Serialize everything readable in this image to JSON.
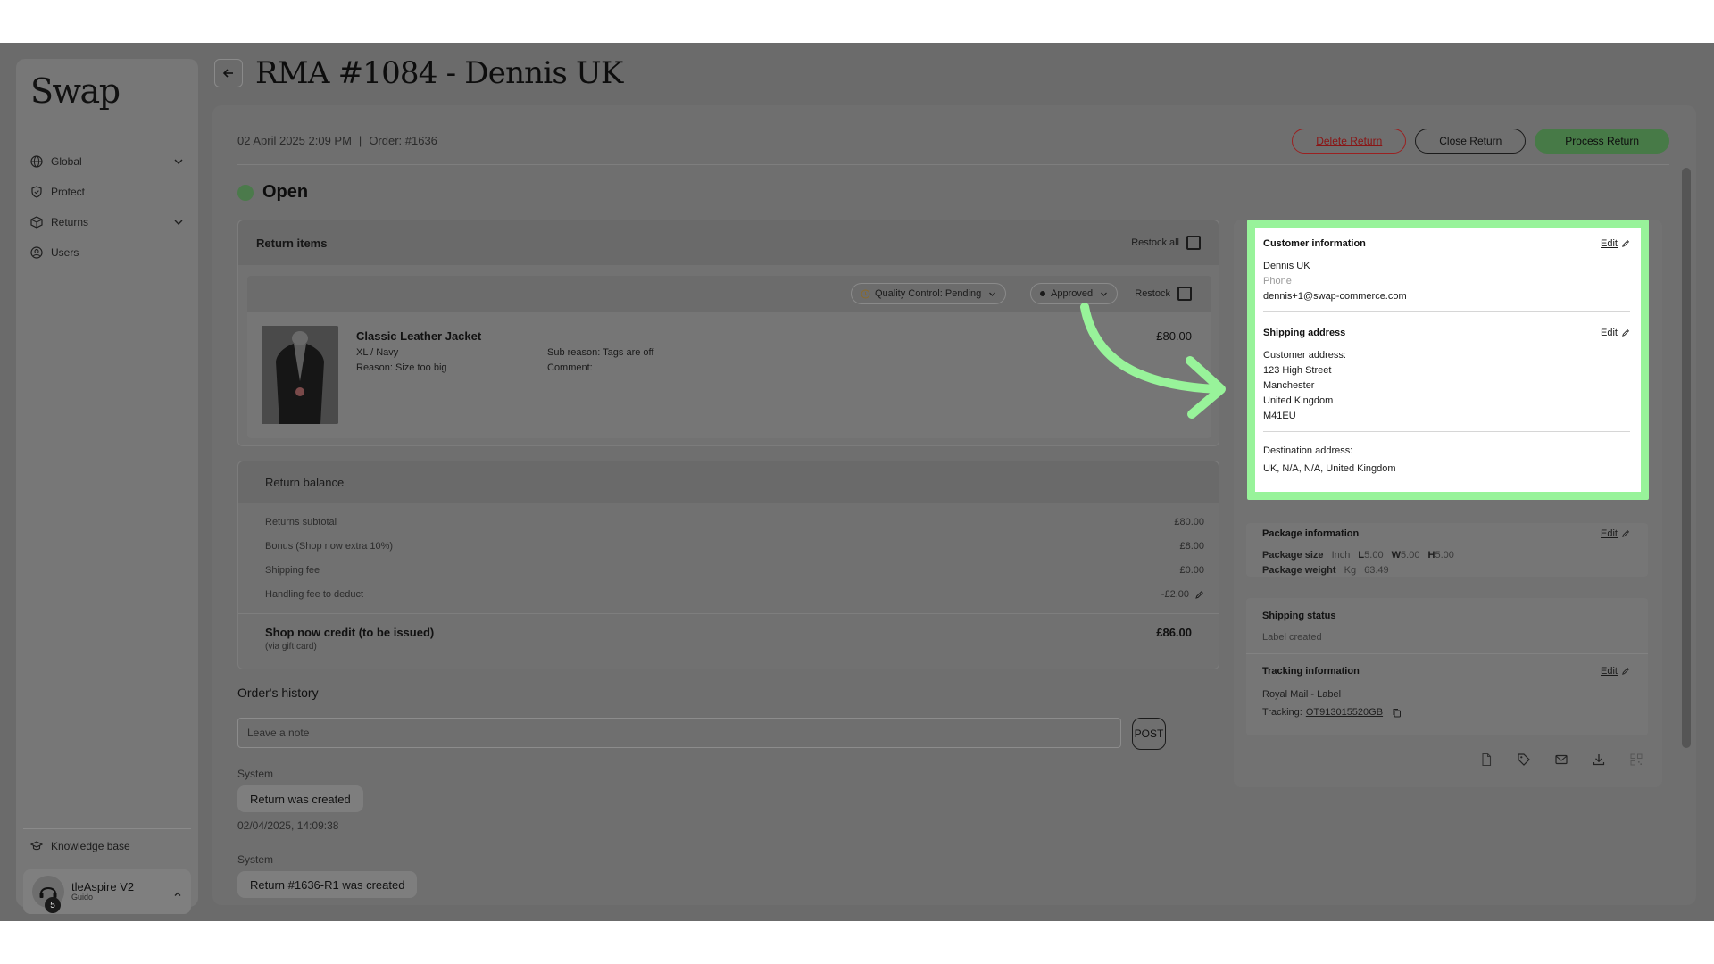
{
  "brand": {
    "logo": "Swap"
  },
  "sidebar": {
    "items": [
      {
        "label": "Global",
        "icon": "globe-icon",
        "expandable": true
      },
      {
        "label": "Protect",
        "icon": "shield-icon",
        "expandable": false
      },
      {
        "label": "Returns",
        "icon": "box-icon",
        "expandable": true
      },
      {
        "label": "Users",
        "icon": "user-circle-icon",
        "expandable": false
      }
    ],
    "knowledge_base": "Knowledge base",
    "account": {
      "name": "tleAspire V2",
      "sub": "Guido",
      "badge": "5"
    }
  },
  "header": {
    "title": "RMA #1084 - Dennis UK"
  },
  "meta": {
    "date": "02 April 2025 2:09 PM",
    "separator": "|",
    "order": "Order: #1636"
  },
  "actions": {
    "delete": "Delete Return",
    "close": "Close Return",
    "process": "Process Return"
  },
  "status": {
    "label": "Open",
    "color": "#4b7a4b"
  },
  "return_items": {
    "title": "Return items",
    "restock_all": "Restock all",
    "item": {
      "qc_status": "Quality Control: Pending",
      "approval": "Approved",
      "restock": "Restock",
      "name": "Classic Leather Jacket",
      "variant": "XL / Navy",
      "reason": "Reason: Size too big",
      "sub_reason": "Sub reason: Tags are off",
      "comment": "Comment:",
      "price": "£80.00"
    }
  },
  "balance": {
    "title": "Return balance",
    "rows": [
      {
        "label": "Returns subtotal",
        "value": "£80.00"
      },
      {
        "label": "Bonus (Shop now extra 10%)",
        "value": "£8.00"
      },
      {
        "label": "Shipping fee",
        "value": "£0.00"
      },
      {
        "label": "Handling fee to deduct",
        "value": "-£2.00"
      }
    ],
    "total_label": "Shop now credit (to be issued)",
    "total_sub": "(via gift card)",
    "total_value": "£86.00"
  },
  "history": {
    "title": "Order's history",
    "note_placeholder": "Leave a note",
    "post": "POST",
    "entries": [
      {
        "author": "System",
        "text": "Return was created",
        "time": "02/04/2025, 14:09:38"
      },
      {
        "author": "System",
        "text": "Return #1636-R1 was created"
      }
    ]
  },
  "customer": {
    "title": "Customer information",
    "edit": "Edit",
    "name": "Dennis UK",
    "phone": "Phone",
    "email": "dennis+1@swap-commerce.com"
  },
  "shipping": {
    "title": "Shipping address",
    "edit": "Edit",
    "customer_address_label": "Customer address:",
    "address_lines": [
      "123 High Street",
      "Manchester",
      "United Kingdom",
      "M41EU"
    ],
    "destination_label": "Destination address:",
    "destination": "UK, N/A, N/A, United Kingdom"
  },
  "package": {
    "title": "Package information",
    "edit": "Edit",
    "size_label": "Package size",
    "size_unit": "Inch",
    "l_label": "L",
    "l": "5.00",
    "w_label": "W",
    "w": "5.00",
    "h_label": "H",
    "h": "5.00",
    "weight_label": "Package weight",
    "weight_unit": "Kg",
    "weight": "63.49"
  },
  "shipping_status": {
    "title": "Shipping status",
    "value": "Label created"
  },
  "tracking": {
    "title": "Tracking information",
    "edit": "Edit",
    "carrier": "Royal Mail - Label",
    "label": "Tracking:",
    "number": "OT913015520GB"
  },
  "colors": {
    "highlight": "#98f39a",
    "accent_green": "#477a47",
    "danger": "#8a1515"
  }
}
